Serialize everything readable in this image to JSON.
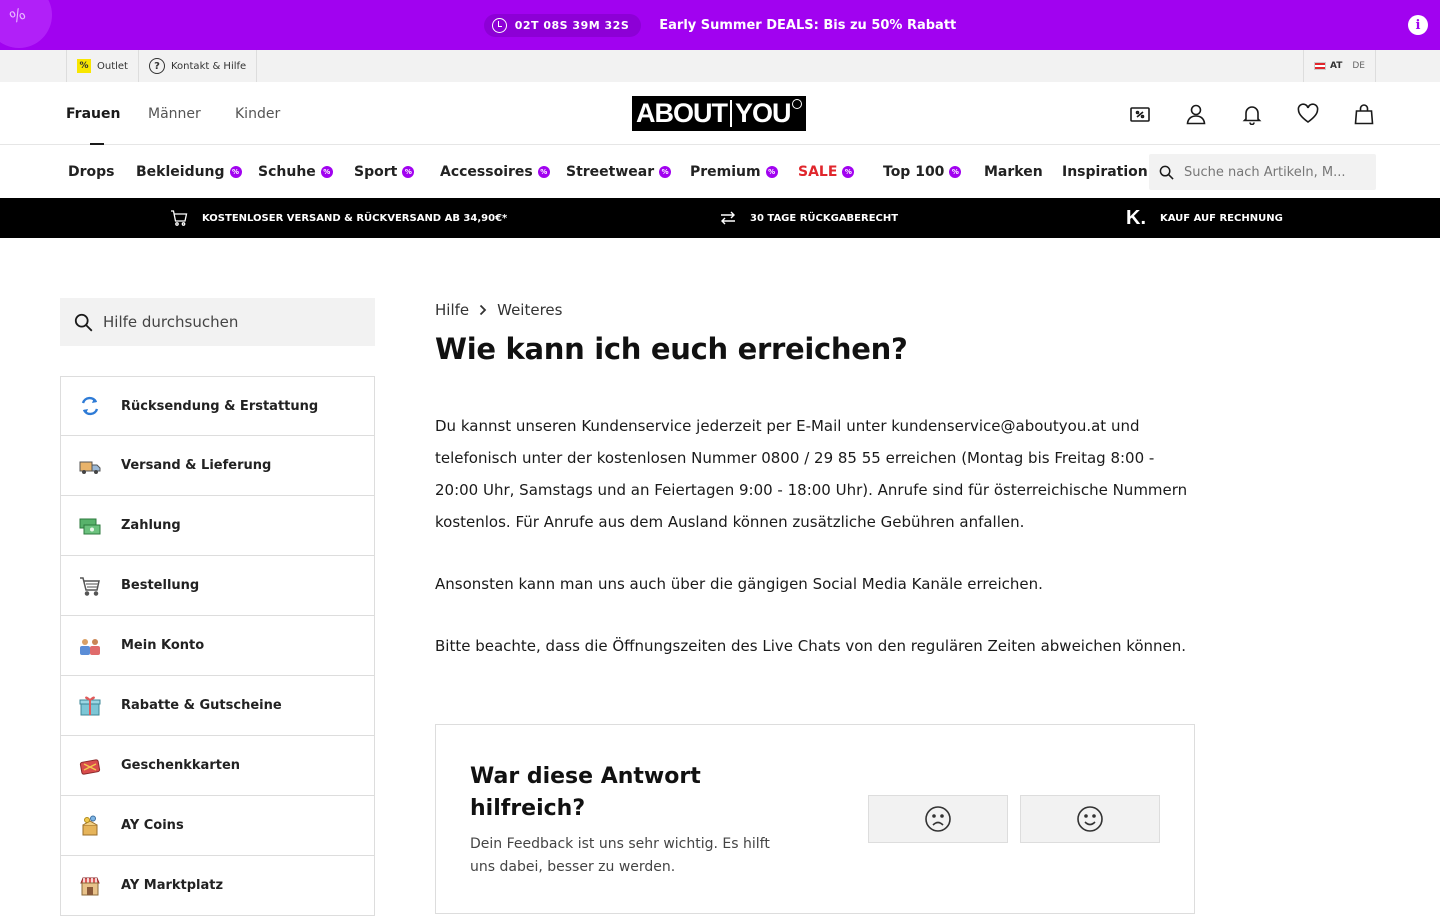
{
  "promo": {
    "countdown": "02T 08S 39M 32S",
    "text": "Early Summer DEALS: Bis zu 50% Rabatt"
  },
  "service": {
    "outlet": "Outlet",
    "help": "Kontakt & Hilfe",
    "lang_at": "AT",
    "lang_de": "DE"
  },
  "header": {
    "genders": [
      "Frauen",
      "Männer",
      "Kinder"
    ],
    "logo": "ABOUT YOU"
  },
  "nav": {
    "categories": [
      "Drops",
      "Bekleidung",
      "Schuhe",
      "Sport",
      "Accessoires",
      "Streetwear",
      "Premium",
      "SALE",
      "Top 100",
      "Marken",
      "Inspiration"
    ],
    "search_placeholder": "Suche nach Artikeln, M..."
  },
  "usp": {
    "shipping": "KOSTENLOSER VERSAND & RÜCKVERSAND AB 34,90€*",
    "returns": "30 TAGE RÜCKGABERECHT",
    "invoice": "KAUF AUF RECHNUNG"
  },
  "sidebar": {
    "search_placeholder": "Hilfe durchsuchen",
    "topics": [
      "Rücksendung & Erstattung",
      "Versand & Lieferung",
      "Zahlung",
      "Bestellung",
      "Mein Konto",
      "Rabatte & Gutscheine",
      "Geschenkkarten",
      "AY Coins",
      "AY Marktplatz"
    ]
  },
  "article": {
    "breadcrumb": [
      "Hilfe",
      "Weiteres"
    ],
    "title": "Wie kann ich euch erreichen?",
    "paragraphs": [
      "Du kannst unseren Kundenservice jederzeit per E-Mail unter kundenservice@aboutyou.at und telefonisch unter der kostenlosen Nummer 0800 / 29 85 55 erreichen (Montag bis Freitag 8:00 - 20:00 Uhr, Samstags und an Feiertagen 9:00 - 18:00 Uhr). Anrufe sind für österreichische Nummern kostenlos. Für Anrufe aus dem Ausland können zusätzliche Gebühren anfallen.",
      "Ansonsten kann man uns auch über die gängigen Social Media Kanäle erreichen.",
      "Bitte beachte, dass die Öffnungszeiten des Live Chats von den regulären Zeiten abweichen können."
    ]
  },
  "feedback": {
    "title": "War diese Antwort hilfreich?",
    "subtitle": "Dein Feedback ist uns sehr wichtig. Es hilft uns dabei, besser zu werden."
  },
  "colors": {
    "promo_purple": "#a102f0",
    "sale_red": "#e0262c",
    "usp_black": "#000000"
  }
}
